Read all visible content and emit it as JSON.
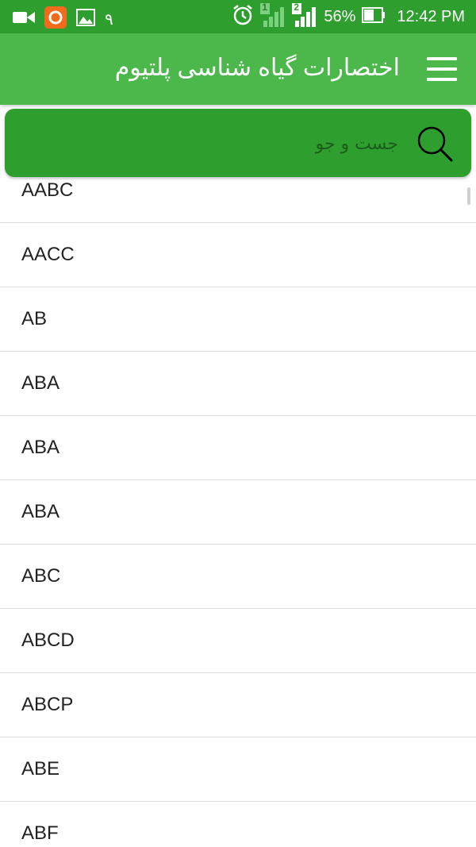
{
  "status_bar": {
    "left_digit": "٩",
    "battery_percent": "56%",
    "time": "12:42 PM",
    "sim1_label": "1",
    "sim2_label": "2",
    "icons": [
      "video-camera-icon",
      "app-notification-icon",
      "gallery-icon",
      "alarm-icon",
      "signal-sim1-icon",
      "signal-sim2-icon",
      "battery-icon"
    ]
  },
  "app_bar": {
    "title": "اختصارات گیاه شناسی پلتیوم",
    "menu_icon": "hamburger-menu-icon"
  },
  "search": {
    "placeholder": "جست و جو",
    "icon": "search-icon"
  },
  "colors": {
    "status_bar": "#2e9e2e",
    "app_bar": "#4cb84c",
    "search_bar": "#2e9e2e"
  },
  "list": {
    "items": [
      "AABC",
      "AACC",
      "AB",
      "ABA",
      "ABA",
      "ABA",
      "ABC",
      "ABCD",
      "ABCP",
      "ABE",
      "ABF"
    ]
  }
}
